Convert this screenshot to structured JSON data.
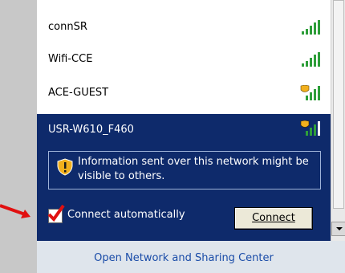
{
  "networks": [
    {
      "name": "connSR",
      "secured": false
    },
    {
      "name": "Wifi-CCE",
      "secured": false
    },
    {
      "name": "ACE-GUEST",
      "secured": true
    }
  ],
  "selected": {
    "name": "USR-W610_F460",
    "info": "Information sent over this network might be visible to others.",
    "auto_label": "Connect automatically",
    "auto_checked": true,
    "connect_label": "Connect"
  },
  "footer": {
    "link": "Open Network and Sharing Center"
  },
  "colors": {
    "selected_bg": "#0e2a6b",
    "signal": "#2e9e3a",
    "shield": "#f2b01d",
    "annotation": "#e11010"
  },
  "icons": {
    "signal": "signal-bars-icon",
    "shield": "shield-warning-icon",
    "arrow": "red-arrow-icon"
  }
}
